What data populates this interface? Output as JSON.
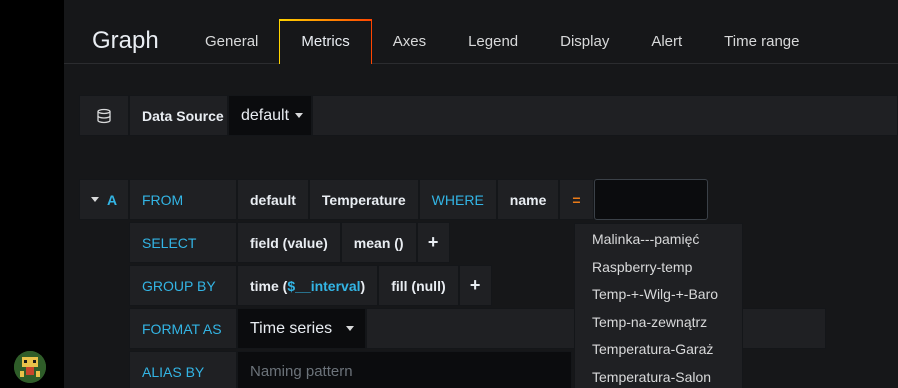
{
  "panel": {
    "title": "Graph"
  },
  "tabs": [
    {
      "label": "General"
    },
    {
      "label": "Metrics"
    },
    {
      "label": "Axes"
    },
    {
      "label": "Legend"
    },
    {
      "label": "Display"
    },
    {
      "label": "Alert"
    },
    {
      "label": "Time range"
    }
  ],
  "datasource": {
    "label": "Data Source",
    "value": "default"
  },
  "query": {
    "ref_id": "A",
    "from": {
      "keyword": "FROM",
      "policy": "default",
      "measurement": "Temperature",
      "where_keyword": "WHERE",
      "tag": "name",
      "operator": "="
    },
    "select": {
      "keyword": "SELECT",
      "field": "field (value)",
      "agg": "mean ()",
      "add": "+"
    },
    "group_by": {
      "keyword": "GROUP BY",
      "time_prefix": "time (",
      "interval": "$__interval",
      "time_suffix": ")",
      "fill": "fill (null)",
      "add": "+"
    },
    "format_as": {
      "keyword": "FORMAT AS",
      "value": "Time series"
    },
    "alias_by": {
      "keyword": "ALIAS BY",
      "placeholder": "Naming pattern"
    }
  },
  "dropdown_options": [
    "Malinka---pamięć",
    "Raspberry-temp",
    "Temp-+-Wilg-+-Baro",
    "Temp-na-zewnątrz",
    "Temperatura-Garaż",
    "Temperatura-Salon"
  ],
  "colors": {
    "keyword": "#33b5e5",
    "operator": "#eb7b18",
    "tab_accent_start": "#ffd500",
    "tab_accent_end": "#ff4400"
  },
  "icons": {
    "datasource": "database-icon",
    "collapse": "caret-down-icon"
  }
}
